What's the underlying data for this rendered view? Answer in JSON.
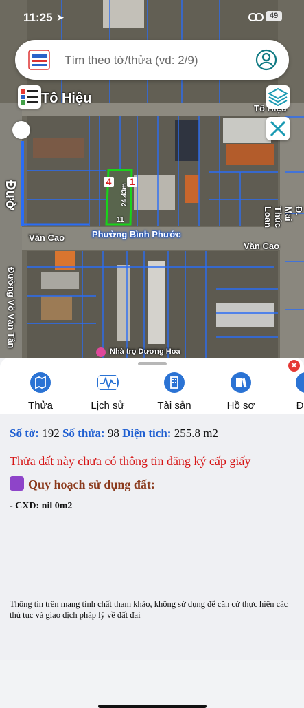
{
  "status_bar": {
    "time": "11:25",
    "battery": "49"
  },
  "search": {
    "placeholder": "Tìm theo tờ/thửa (vd: 2/9)"
  },
  "map": {
    "streets": {
      "to_hieu_main": "Tô Hiệu",
      "to_hieu_right": "Tô Hiệu",
      "van_cao_left": "Văn Cao",
      "van_cao_right": "Văn Cao",
      "duong_left": "Đườ",
      "vo_van_tan": "Đường Võ Văn Tần",
      "mai_thuc_loan": "Đ. Mai Thúc Loan"
    },
    "ward_label": "Phường Bình Phước",
    "parcel": {
      "corner_1": "1",
      "corner_4": "4",
      "dim_side": "24.43m",
      "dim_bottom": "11"
    },
    "poi_label": "Nhà trọ Dương Hoa"
  },
  "tabs": [
    {
      "label": "Thửa"
    },
    {
      "label": "Lịch sử"
    },
    {
      "label": "Tài sản"
    },
    {
      "label": "Hồ sơ"
    },
    {
      "label": "Đ"
    }
  ],
  "parcel_info": {
    "so_to_label": "Số tờ:",
    "so_to_value": "192",
    "so_thua_label": "Số thửa:",
    "so_thua_value": "98",
    "dien_tich_label": "Diện tích:",
    "dien_tich_value": "255.8 m2",
    "warning": "Thửa đất này chưa có thông tin đăng ký cấp giấy",
    "planning_title": "Quy hoạch sử dụng đất:",
    "cxd_line": "- CXD: nil 0m2",
    "disclaimer": "Thông tin trên mang tính chất tham khảo, không sử dụng để căn cứ thực hiện các thủ tục và giao dịch pháp lý về đất đai"
  },
  "colors": {
    "accent_blue": "#1f5fd1",
    "warning_red": "#d61515",
    "planning_brown": "#8b3a1c",
    "parcel_green": "#19d41a",
    "boundary_blue": "#2a6df5"
  }
}
